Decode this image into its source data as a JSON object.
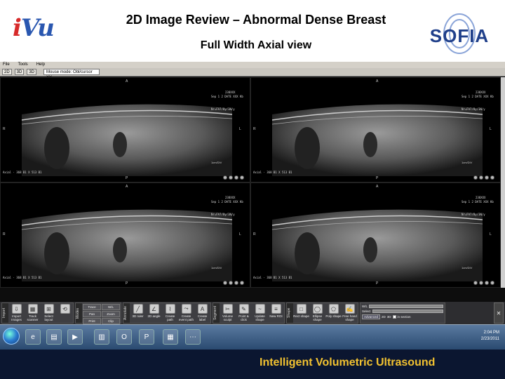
{
  "header": {
    "title": "2D Image Review – Abnormal Dense Breast",
    "subtitle": "Full Width Axial view",
    "logo_left": "iVu",
    "logo_right": "SOFIA"
  },
  "app": {
    "menu": [
      "File",
      "Tools",
      "Help"
    ],
    "toolbar_top": [
      "2D",
      "3D",
      "3D"
    ],
    "mouse_mode": "Mouse mode: Obl/cursor XY",
    "viewports": [
      {
        "name": "viewport-top-left",
        "header": "238XXX",
        "sub": "Sep 1 2 DATE XXX Kb",
        "mode": "Nr=FA7/8y/3N/y",
        "orient_top": "A",
        "orient_left": "R",
        "orient_right": "L",
        "orient_bottom": "P",
        "scale": "1cm/DIV",
        "info": "Axial · 368 B1 X 513 B1"
      },
      {
        "name": "viewport-top-right",
        "header": "238XXX",
        "sub": "Sep 1 2 DATE XXX Kb",
        "mode": "Nr=FA7/8y/3N/y",
        "orient_top": "A",
        "orient_left": "R",
        "orient_right": "L",
        "orient_bottom": "P",
        "scale": "1cm/DIV",
        "info": "Axial · 368 B1 X 513 B1"
      },
      {
        "name": "viewport-bottom-left",
        "header": "238XXX",
        "sub": "Sep 1 2 DATE XXX Kb",
        "mode": "Nr=FA7/8y/3N/y",
        "orient_top": "A",
        "orient_left": "R",
        "orient_right": "L",
        "orient_bottom": "P",
        "scale": "1cm/DIV",
        "info": "Axial · 368 B1 X 513 B1"
      },
      {
        "name": "viewport-bottom-right",
        "header": "238XXX",
        "sub": "Sep 1 2 DATE XXX Kb",
        "mode": "Nr=FA7/8y/3N/y",
        "orient_top": "A",
        "orient_left": "R",
        "orient_right": "L",
        "orient_bottom": "P",
        "scale": "1cm/DIV",
        "info": "Axial · 368 B1 X 513 B1"
      }
    ],
    "tool_groups": [
      {
        "label": "Import",
        "tools": [
          {
            "n": "import-images",
            "l": "Import Images",
            "i": "⇩"
          },
          {
            "n": "track-scanner",
            "l": "Track scanner",
            "i": "▦"
          },
          {
            "n": "select-layout",
            "l": "Select layout",
            "i": "⊞"
          },
          {
            "n": "reset-tool",
            "l": "",
            "i": "⟲"
          }
        ]
      },
      {
        "label": "Modes",
        "grid": [
          "Trace",
          "W/L",
          "Pan",
          "Zoom",
          "Print",
          "Clip",
          "Export",
          "Screen",
          "Target",
          "Displace"
        ]
      },
      {
        "label": "Annotate",
        "tools": [
          {
            "n": "3d-ruler",
            "l": "3D ruler",
            "i": "╱"
          },
          {
            "n": "2d-angle",
            "l": "2D angle",
            "i": "∠"
          },
          {
            "n": "create-path",
            "l": "Create path",
            "i": "⌇"
          },
          {
            "n": "create-event-path",
            "l": "Create event path",
            "i": "⤳"
          },
          {
            "n": "create-label",
            "l": "Create label",
            "i": "A"
          }
        ]
      },
      {
        "label": "Segment",
        "tools": [
          {
            "n": "volume-sculpt",
            "l": "Volume sculpt",
            "i": "✂"
          },
          {
            "n": "point-click",
            "l": "Point & click",
            "i": "✎"
          },
          {
            "n": "update-shape",
            "l": "Update shape",
            "i": "~"
          },
          {
            "n": "new-roi",
            "l": "New ROI",
            "i": "≡"
          }
        ]
      },
      {
        "label": "Shape",
        "tools": [
          {
            "n": "rect-shape",
            "l": "Rect shape",
            "i": "□"
          },
          {
            "n": "ellipse-shape",
            "l": "Ellipse shape",
            "i": "◯"
          },
          {
            "n": "poly-shape",
            "l": "Poly shape",
            "i": "⬠"
          },
          {
            "n": "free-hand-shape",
            "l": "Free hand shape",
            "i": "✍"
          }
        ]
      }
    ],
    "wl_panel": {
      "wl": "W/L",
      "select": "Select",
      "advanced": "Advanced",
      "opt_2d": "2D",
      "opt_3d": "3D",
      "section": "in section"
    }
  },
  "taskbar": {
    "time": "2:04 PM",
    "date": "2/23/2011"
  },
  "footer": {
    "text": "Intelligent Volumetric Ultrasound"
  },
  "colors": {
    "footer_bg": "#0b1630",
    "footer_text": "#f2c230",
    "title": "#000000"
  }
}
